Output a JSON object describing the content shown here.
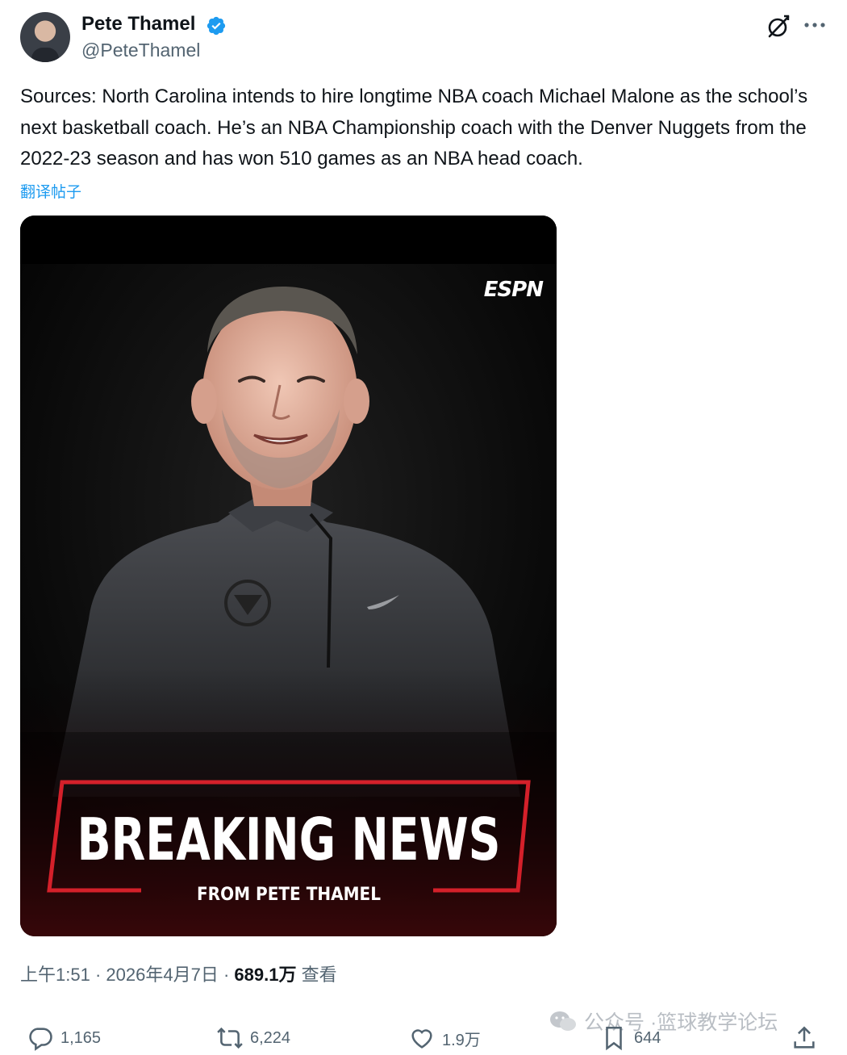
{
  "author": {
    "name": "Pete Thamel",
    "handle": "@PeteThamel"
  },
  "post": {
    "text": "Sources: North Carolina intends to hire longtime NBA coach Michael Malone as the school’s next basketball coach. He’s an NBA Championship coach with the Denver Nuggets from the 2022-23 season and has won 510 games as an NBA head coach.",
    "translate_label": "翻译帖子"
  },
  "media": {
    "brand": "ESPN",
    "headline": "BREAKING NEWS",
    "subhead": "FROM PETE THAMEL"
  },
  "meta": {
    "time": "上午1:51",
    "date": "2026年4月7日",
    "views_count": "689.1万",
    "views_label": "查看"
  },
  "actions": {
    "replies": "1,165",
    "reposts": "6,224",
    "likes": "1.9万",
    "bookmarks": "644"
  },
  "watermark": {
    "prefix": "公众号 · ",
    "account": "篮球教学论坛"
  },
  "colors": {
    "accent": "#1d9bf0",
    "text": "#0f1419",
    "muted": "#536471",
    "espn_red": "#d4202a"
  }
}
